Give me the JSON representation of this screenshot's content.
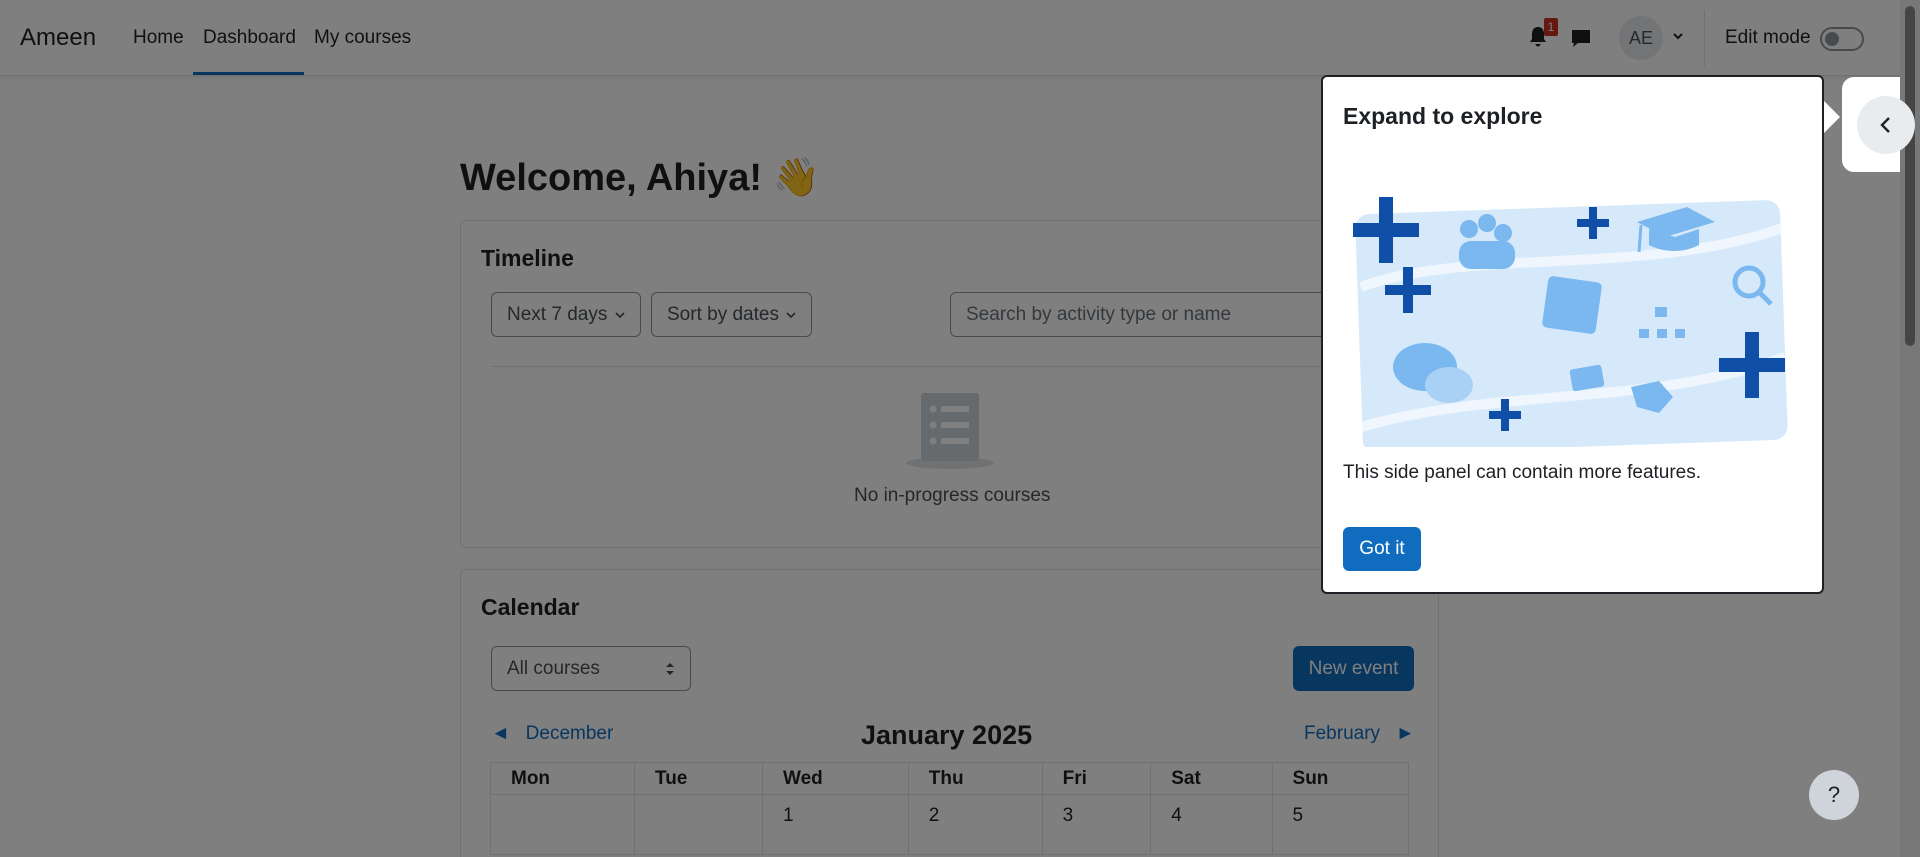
{
  "navbar": {
    "brand": "Ameen",
    "links": [
      "Home",
      "Dashboard",
      "My courses"
    ],
    "notification_count": "1",
    "avatar_initials": "AE",
    "edit_mode_label": "Edit mode"
  },
  "welcome": {
    "title": "Welcome, Ahiya! 👋"
  },
  "timeline": {
    "title": "Timeline",
    "filter_label": "Next 7 days",
    "sort_label": "Sort by dates",
    "search_placeholder": "Search by activity type or name",
    "empty_text": "No in-progress courses"
  },
  "calendar": {
    "title": "Calendar",
    "course_select": "All courses",
    "new_event_label": "New event",
    "prev_month": "December",
    "current_month": "January 2025",
    "next_month": "February",
    "weekdays": [
      "Mon",
      "Tue",
      "Wed",
      "Thu",
      "Fri",
      "Sat",
      "Sun"
    ],
    "first_week": [
      "",
      "",
      "1",
      "2",
      "3",
      "4",
      "5"
    ]
  },
  "popover": {
    "title": "Expand to explore",
    "text": "This side panel can contain more features.",
    "button_label": "Got it"
  },
  "help": {
    "label": "?"
  },
  "colors": {
    "primary": "#0f6cbf",
    "badge": "#ca3120",
    "backdrop": "rgba(0,0,0,0.5)"
  }
}
